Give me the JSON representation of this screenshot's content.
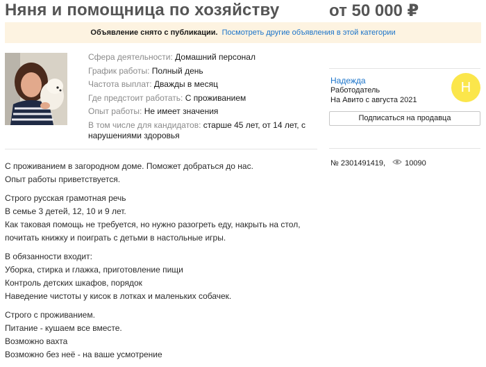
{
  "header": {
    "title": "Няня и помощница по хозяйству",
    "price": "от 50 000 ₽"
  },
  "banner": {
    "text": "Объявление снято с публикации.",
    "link": "Посмотреть другие объявления в этой категории"
  },
  "params": [
    {
      "key": "Сфера деятельности:",
      "value": "Домашний персонал"
    },
    {
      "key": "График работы:",
      "value": "Полный день"
    },
    {
      "key": "Частота выплат:",
      "value": "Дважды в месяц"
    },
    {
      "key": "Где предстоит работать:",
      "value": "С проживанием"
    },
    {
      "key": "Опыт работы:",
      "value": "Не имеет значения"
    },
    {
      "key": "В том числе для кандидатов:",
      "value": "старше 45 лет, от 14 лет, с нарушениями здоровья"
    }
  ],
  "seller": {
    "name": "Надежда",
    "role": "Работодатель",
    "since": "На Авито с августа 2021",
    "avatar_letter": "Н",
    "avatar_color": "#fbe64b",
    "subscribe_label": "Подписаться на продавца"
  },
  "ad": {
    "number": "№ 2301491419,",
    "views": "10090",
    "views_icon": "eye-icon"
  },
  "description": [
    [
      "С проживанием в загородном доме. Поможет добраться до нас.",
      "Опыт работы приветствуется."
    ],
    [
      "Строго русская грамотная речь",
      "В семье 3 детей, 12, 10 и 9 лет.",
      "Как таковая помощь не требуется, но нужно разогреть еду, накрыть на стол, почитать книжку и поиграть с детьми в настольные игры."
    ],
    [
      "В обязанности входит:",
      "Уборка, стирка и глажка, приготовление пищи",
      "Контроль детских шкафов, порядок",
      "Наведение чистоты у кисок в лотках и маленьких собачек."
    ],
    [
      "Строго с проживанием.",
      "Питание - кушаем все вместе.",
      "Возможно вахта",
      "Возможно без неё - на ваше усмотрение"
    ]
  ],
  "colors": {
    "link": "#1a73c9",
    "banner_bg": "#fdf3e1",
    "muted": "#8a8a8a"
  }
}
